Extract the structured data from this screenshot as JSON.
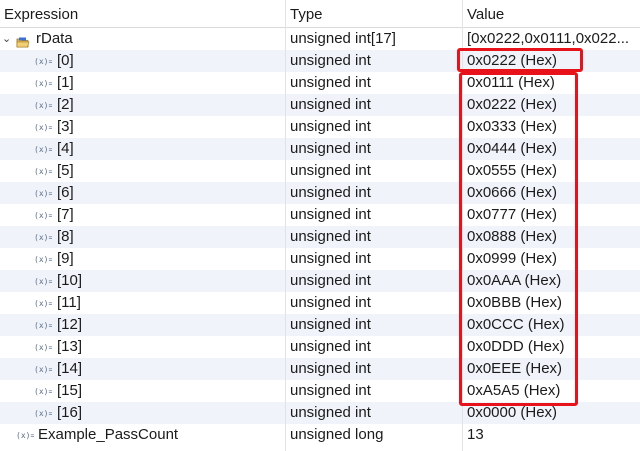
{
  "headers": {
    "expression": "Expression",
    "type": "Type",
    "value": "Value"
  },
  "root": {
    "name": "rData",
    "type": "unsigned int[17]",
    "value": "[0x0222,0x0111,0x022...",
    "expanded": true
  },
  "elements": [
    {
      "name": "[0]",
      "type": "unsigned int",
      "value": "0x0222 (Hex)"
    },
    {
      "name": "[1]",
      "type": "unsigned int",
      "value": "0x0111 (Hex)"
    },
    {
      "name": "[2]",
      "type": "unsigned int",
      "value": "0x0222 (Hex)"
    },
    {
      "name": "[3]",
      "type": "unsigned int",
      "value": "0x0333 (Hex)"
    },
    {
      "name": "[4]",
      "type": "unsigned int",
      "value": "0x0444 (Hex)"
    },
    {
      "name": "[5]",
      "type": "unsigned int",
      "value": "0x0555 (Hex)"
    },
    {
      "name": "[6]",
      "type": "unsigned int",
      "value": "0x0666 (Hex)"
    },
    {
      "name": "[7]",
      "type": "unsigned int",
      "value": "0x0777 (Hex)"
    },
    {
      "name": "[8]",
      "type": "unsigned int",
      "value": "0x0888 (Hex)"
    },
    {
      "name": "[9]",
      "type": "unsigned int",
      "value": "0x0999 (Hex)"
    },
    {
      "name": "[10]",
      "type": "unsigned int",
      "value": "0x0AAA (Hex)"
    },
    {
      "name": "[11]",
      "type": "unsigned int",
      "value": "0x0BBB (Hex)"
    },
    {
      "name": "[12]",
      "type": "unsigned int",
      "value": "0x0CCC (Hex)"
    },
    {
      "name": "[13]",
      "type": "unsigned int",
      "value": "0x0DDD (Hex)"
    },
    {
      "name": "[14]",
      "type": "unsigned int",
      "value": "0x0EEE (Hex)"
    },
    {
      "name": "[15]",
      "type": "unsigned int",
      "value": "0xA5A5 (Hex)"
    },
    {
      "name": "[16]",
      "type": "unsigned int",
      "value": "0x0000 (Hex)"
    }
  ],
  "extra": {
    "name": "Example_PassCount",
    "type": "unsigned long",
    "value": "13"
  },
  "icons": {
    "expand": "chevron-down-icon",
    "struct": "folder-struct-icon",
    "variable": "variable-icon"
  },
  "colors": {
    "highlight": "#e8121b",
    "alt_row": "#f0f4fa"
  }
}
